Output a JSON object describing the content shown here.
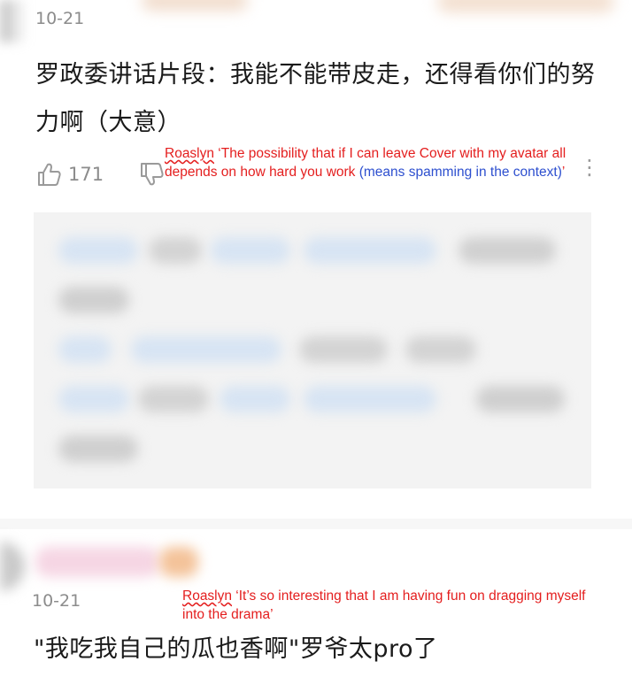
{
  "post1": {
    "date": "10-21",
    "title": "罗政委讲话片段：我能不能带皮走，还得看你们的努力啊（大意）",
    "like_count": "171",
    "annotation": {
      "author": "Roaslyn",
      "quote_text": " ‘The possibility that if I can leave Cover with my avatar all depends on how hard you work ",
      "note": "(means spamming in the context)",
      "close": "’"
    }
  },
  "post2": {
    "date": "10-21",
    "text": "\"我吃我自己的瓜也香啊\"罗爷太pro了",
    "annotation": {
      "author": "Roaslyn",
      "quote_text": " ‘It’s so interesting that I am having fun on dragging myself into the drama’"
    }
  },
  "icons": {
    "like": "thumbs-up-icon",
    "dislike": "thumbs-down-icon",
    "more": "more-vertical-icon"
  },
  "colors": {
    "annotation_red": "#e41e1e",
    "annotation_blue": "#2d4fcf",
    "meta_gray": "#8c8c8c"
  }
}
